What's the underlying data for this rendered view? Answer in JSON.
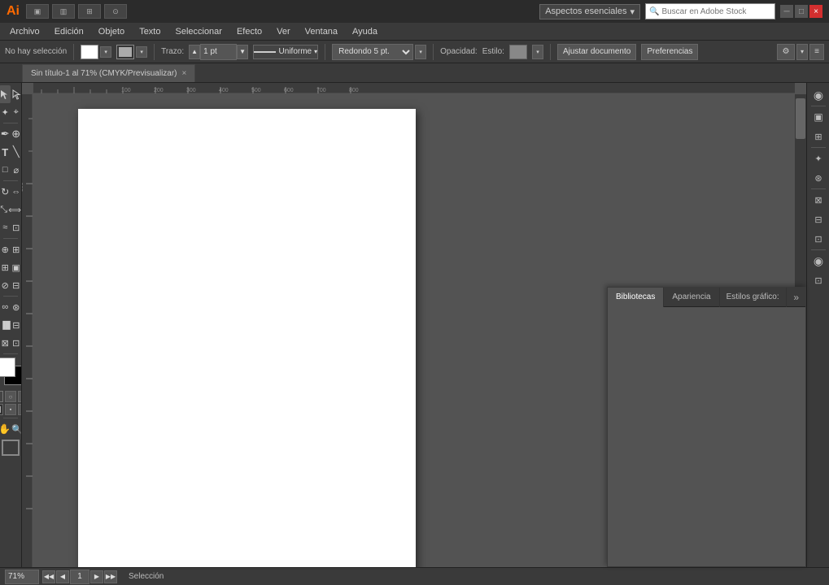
{
  "app": {
    "logo": "Ai",
    "title": "Sin título-1 al 71% (CMYK/Previsualizar)"
  },
  "title_bar": {
    "workspace_label": "Aspectos esenciales",
    "search_placeholder": "Buscar en Adobe Stock",
    "icons": [
      "▣",
      "▥",
      "⊞",
      "⊙"
    ]
  },
  "menu": {
    "items": [
      "Archivo",
      "Edición",
      "Objeto",
      "Texto",
      "Seleccionar",
      "Efecto",
      "Ver",
      "Ventana",
      "Ayuda"
    ]
  },
  "options_bar": {
    "selection_label": "No hay selección",
    "stroke_label": "Trazo:",
    "stroke_value": "1 pt",
    "stroke_type": "Uniforme",
    "cap_label": "Redondo 5 pt.",
    "opacity_label": "Opacidad:",
    "style_label": "Estilo:",
    "adjust_btn": "Ajustar documento",
    "prefs_btn": "Preferencias"
  },
  "tab": {
    "label": "Sin título-1 al 71% (CMYK/Previsualizar)",
    "close": "×"
  },
  "panel": {
    "tabs": [
      "Bibliotecas",
      "Apariencia",
      "Estilos gráfico:"
    ],
    "more": "»"
  },
  "status_bar": {
    "zoom": "71%",
    "nav_prev_prev": "◀◀",
    "nav_prev": "◀",
    "page_num": "1",
    "nav_next": "▶",
    "nav_next_next": "▶▶",
    "selection_info": "Selección"
  },
  "tools": {
    "left": [
      {
        "name": "selection",
        "icon": "↖",
        "title": "Selección"
      },
      {
        "name": "direct-selection",
        "icon": "↗",
        "title": "Selección directa"
      },
      {
        "name": "magic-wand",
        "icon": "✦",
        "title": "Varita mágica"
      },
      {
        "name": "lasso",
        "icon": "⌖",
        "title": "Lazo"
      },
      {
        "name": "pen",
        "icon": "✒",
        "title": "Pluma"
      },
      {
        "name": "add-anchor",
        "icon": "+",
        "title": "Añadir punto"
      },
      {
        "name": "type",
        "icon": "T",
        "title": "Texto"
      },
      {
        "name": "line",
        "icon": "╲",
        "title": "Línea"
      },
      {
        "name": "rectangle",
        "icon": "□",
        "title": "Rectángulo"
      },
      {
        "name": "rotate",
        "icon": "↻",
        "title": "Rotar"
      },
      {
        "name": "reflect",
        "icon": "◫",
        "title": "Reflejar"
      },
      {
        "name": "scale",
        "icon": "⤡",
        "title": "Escalar"
      },
      {
        "name": "width",
        "icon": "⟺",
        "title": "Ancho"
      },
      {
        "name": "warp",
        "icon": "⌀",
        "title": "Deformar"
      },
      {
        "name": "free-transform",
        "icon": "⊡",
        "title": "Transformación libre"
      },
      {
        "name": "shape-builder",
        "icon": "⊕",
        "title": "Generador de formas"
      },
      {
        "name": "perspective",
        "icon": "⊞",
        "title": "Perspectiva"
      },
      {
        "name": "mesh",
        "icon": "⊞",
        "title": "Malla"
      },
      {
        "name": "gradient",
        "icon": "▣",
        "title": "Degradado"
      },
      {
        "name": "eyedropper",
        "icon": "⊘",
        "title": "Cuentagotas"
      },
      {
        "name": "measure",
        "icon": "📐",
        "title": "Medir"
      },
      {
        "name": "blend",
        "icon": "∞",
        "title": "Fusión"
      },
      {
        "name": "symbol",
        "icon": "⊛",
        "title": "Símbolo"
      },
      {
        "name": "column-graph",
        "icon": "📊",
        "title": "Gráfico"
      },
      {
        "name": "artboard",
        "icon": "⊟",
        "title": "Mesa de trabajo"
      },
      {
        "name": "slice",
        "icon": "⊠",
        "title": "Segmentar"
      },
      {
        "name": "hand",
        "icon": "✋",
        "title": "Mano"
      },
      {
        "name": "zoom-tool",
        "icon": "🔍",
        "title": "Zoom"
      }
    ],
    "right": [
      {
        "name": "color-wheel",
        "icon": "◉"
      },
      {
        "name": "color-picker",
        "icon": "▣"
      },
      {
        "name": "gradient-panel",
        "icon": "⊡"
      },
      {
        "name": "swatches",
        "icon": "⊞"
      },
      {
        "name": "brushes",
        "icon": "✦"
      },
      {
        "name": "symbols",
        "icon": "⊛"
      },
      {
        "name": "graphic-styles",
        "icon": "⊠"
      },
      {
        "name": "layers",
        "icon": "⊟"
      },
      {
        "name": "links",
        "icon": "🔗"
      },
      {
        "name": "transform",
        "icon": "⊡"
      },
      {
        "name": "align",
        "icon": "⊞"
      },
      {
        "name": "pathfinder",
        "icon": "⊕"
      },
      {
        "name": "cc-libraries",
        "icon": "◉"
      },
      {
        "name": "asset-export",
        "icon": "⊡"
      }
    ]
  },
  "colors": {
    "foreground": "#ffffff",
    "background": "#000000",
    "mode_icons": [
      "▣",
      "○",
      "⊡"
    ]
  }
}
